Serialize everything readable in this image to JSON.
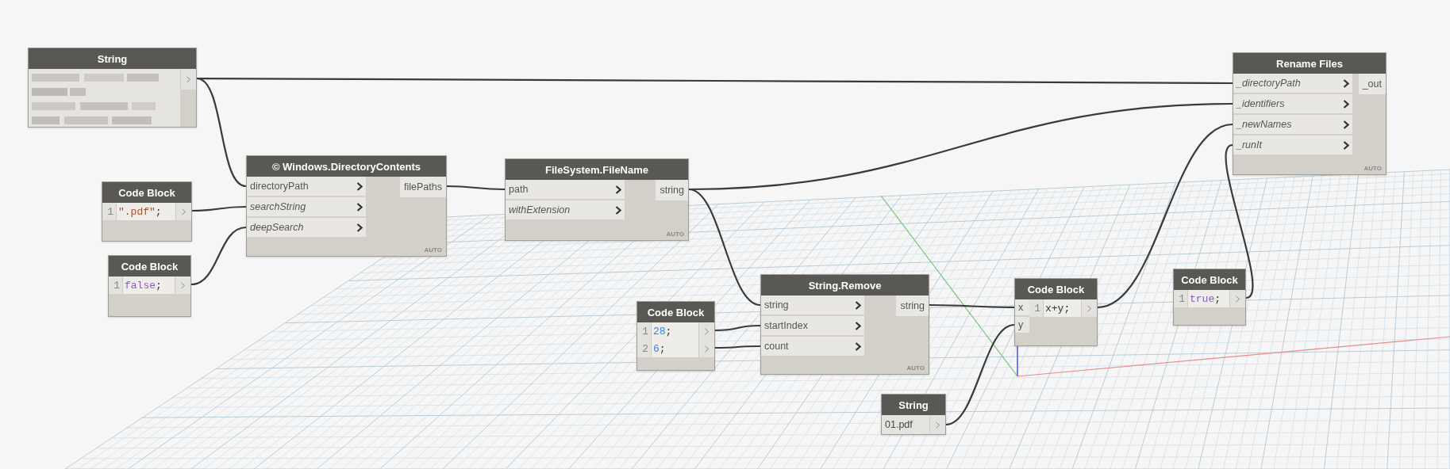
{
  "nodes": [
    {
      "kind": "string",
      "title": "String"
    },
    {
      "kind": "code_block",
      "title": "Code Block",
      "lines": [
        {
          "number": "1",
          "code": "\".pdf\"",
          "end": ";",
          "color": "#a0522d"
        }
      ]
    },
    {
      "kind": "code_block",
      "title": "Code Block",
      "lines": [
        {
          "number": "1",
          "code": "false",
          "end": ";",
          "color": "#8a5fb5"
        }
      ]
    },
    {
      "kind": "function",
      "title": "© Windows.DirectoryContents",
      "inputs": [
        {
          "label": "directoryPath",
          "optional": false
        },
        {
          "label": "searchString",
          "optional": true
        },
        {
          "label": "deepSearch",
          "optional": true
        }
      ],
      "outputs": [
        "filePaths"
      ],
      "lacing": "AUTO"
    },
    {
      "kind": "function",
      "title": "FileSystem.FileName",
      "inputs": [
        {
          "label": "path",
          "optional": false
        },
        {
          "label": "withExtension",
          "optional": true
        }
      ],
      "outputs": [
        "string"
      ],
      "lacing": "AUTO"
    },
    {
      "kind": "code_block",
      "title": "Code Block",
      "lines": [
        {
          "number": "1",
          "code": "28",
          "end": ";",
          "color": "#3f86d6"
        },
        {
          "number": "2",
          "code": "6",
          "end": ";",
          "color": "#3f86d6"
        }
      ]
    },
    {
      "kind": "function",
      "title": "String.Remove",
      "inputs": [
        {
          "label": "string",
          "optional": false
        },
        {
          "label": "startIndex",
          "optional": false
        },
        {
          "label": "count",
          "optional": false
        }
      ],
      "outputs": [
        "string"
      ],
      "lacing": "AUTO"
    },
    {
      "kind": "string",
      "title": "String",
      "value": "01.pdf"
    },
    {
      "kind": "code_block",
      "title": "Code Block",
      "inputs": [
        {
          "label": "x",
          "optional": false
        },
        {
          "label": "y",
          "optional": false
        }
      ],
      "lines": [
        {
          "number": "1",
          "code": "x+y",
          "end": ";",
          "color": "#333333"
        }
      ]
    },
    {
      "kind": "code_block",
      "title": "Code Block",
      "lines": [
        {
          "number": "1",
          "code": "true",
          "end": ";",
          "color": "#8a5fb5"
        }
      ]
    },
    {
      "kind": "function",
      "title": "Rename Files",
      "inputs": [
        {
          "label": "_directoryPath",
          "optional": true
        },
        {
          "label": "_identifiers",
          "optional": true
        },
        {
          "label": "_newNames",
          "optional": true
        },
        {
          "label": "_runIt",
          "optional": true
        }
      ],
      "outputs": [
        "_out"
      ],
      "lacing": "AUTO"
    }
  ]
}
